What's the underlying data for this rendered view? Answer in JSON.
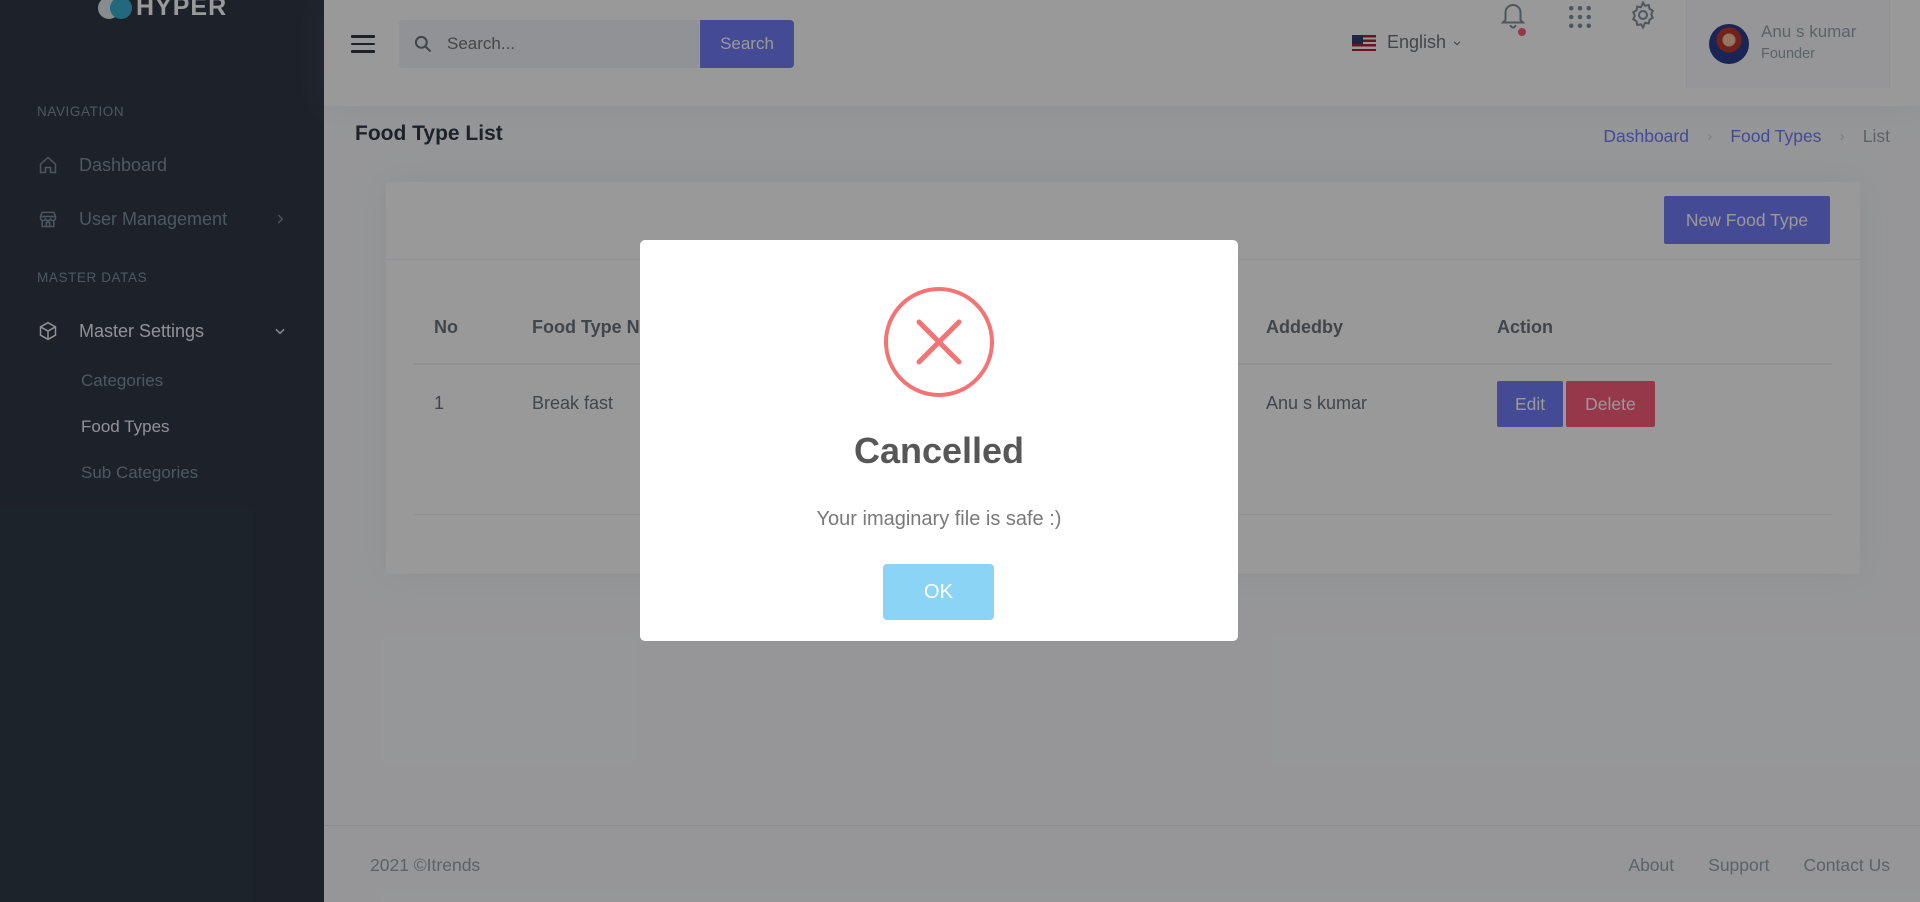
{
  "brand": {
    "name": "HYPER"
  },
  "sidebar": {
    "section_navigation": "NAVIGATION",
    "section_master": "MASTER DATAS",
    "items": [
      {
        "label": "Dashboard",
        "icon": "home-icon"
      },
      {
        "label": "User Management",
        "icon": "store-icon"
      },
      {
        "label": "Master Settings",
        "icon": "cube-icon",
        "expanded": true
      }
    ],
    "sub_items": [
      {
        "label": "Categories"
      },
      {
        "label": "Food Types",
        "active": true
      },
      {
        "label": "Sub Categories"
      }
    ]
  },
  "topbar": {
    "search_placeholder": "Search...",
    "search_button": "Search",
    "language": "English",
    "user_name": "Anu s kumar",
    "user_role": "Founder"
  },
  "page": {
    "title": "Food Type List",
    "breadcrumb": [
      "Dashboard",
      "Food Types",
      "List"
    ]
  },
  "card": {
    "new_button": "New Food Type",
    "columns": [
      "No",
      "Food Type N",
      "Addedby",
      "Action"
    ],
    "rows": [
      {
        "no": "1",
        "name": "Break fast",
        "added_by": "Anu s kumar",
        "edit": "Edit",
        "delete": "Delete"
      }
    ]
  },
  "footer": {
    "copyright": "2021 ©Itrends",
    "links": [
      "About",
      "Support",
      "Contact Us"
    ]
  },
  "modal": {
    "title": "Cancelled",
    "text": "Your imaginary file is safe :)",
    "ok": "OK"
  },
  "colors": {
    "primary": "#727cf5",
    "danger": "#fa5c7c",
    "sidebar_bg": "#313a46",
    "error_icon": "#f27474",
    "ok_button": "#8cd4f5"
  }
}
